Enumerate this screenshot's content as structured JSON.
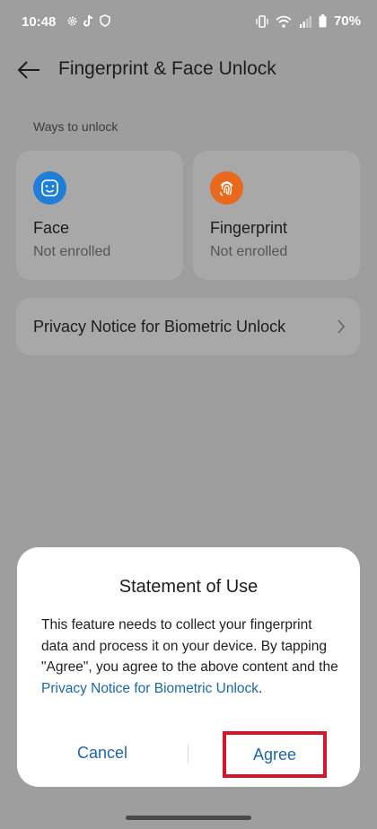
{
  "status_bar": {
    "time": "10:48",
    "battery": "70%",
    "left_icons": [
      "gear-icon",
      "tiktok-icon",
      "shield-icon"
    ],
    "right_icons": [
      "vibrate-icon",
      "wifi-icon",
      "signal-icon",
      "battery-icon"
    ]
  },
  "header": {
    "title": "Fingerprint & Face Unlock",
    "back_icon": "back-arrow-icon"
  },
  "section": {
    "label": "Ways to unlock"
  },
  "options": [
    {
      "title": "Face",
      "status": "Not enrolled",
      "icon": "face-icon",
      "icon_color": "#1f7fd6"
    },
    {
      "title": "Fingerprint",
      "status": "Not enrolled",
      "icon": "fingerprint-icon",
      "icon_color": "#e8681c"
    }
  ],
  "privacy": {
    "label": "Privacy Notice for Biometric Unlock",
    "chevron_icon": "chevron-right-icon"
  },
  "dialog": {
    "title": "Statement of Use",
    "body_text": "This feature needs to collect your fingerprint data and process it on your device. By tapping \"Agree\", you agree to the above content and the ",
    "link_text": "Privacy Notice for Biometric Unlock",
    "body_end": ".",
    "cancel_label": "Cancel",
    "agree_label": "Agree",
    "highlight_color": "#d7142a"
  },
  "colors": {
    "accent": "#1a66b3",
    "scrim": "#9e9e9e"
  }
}
